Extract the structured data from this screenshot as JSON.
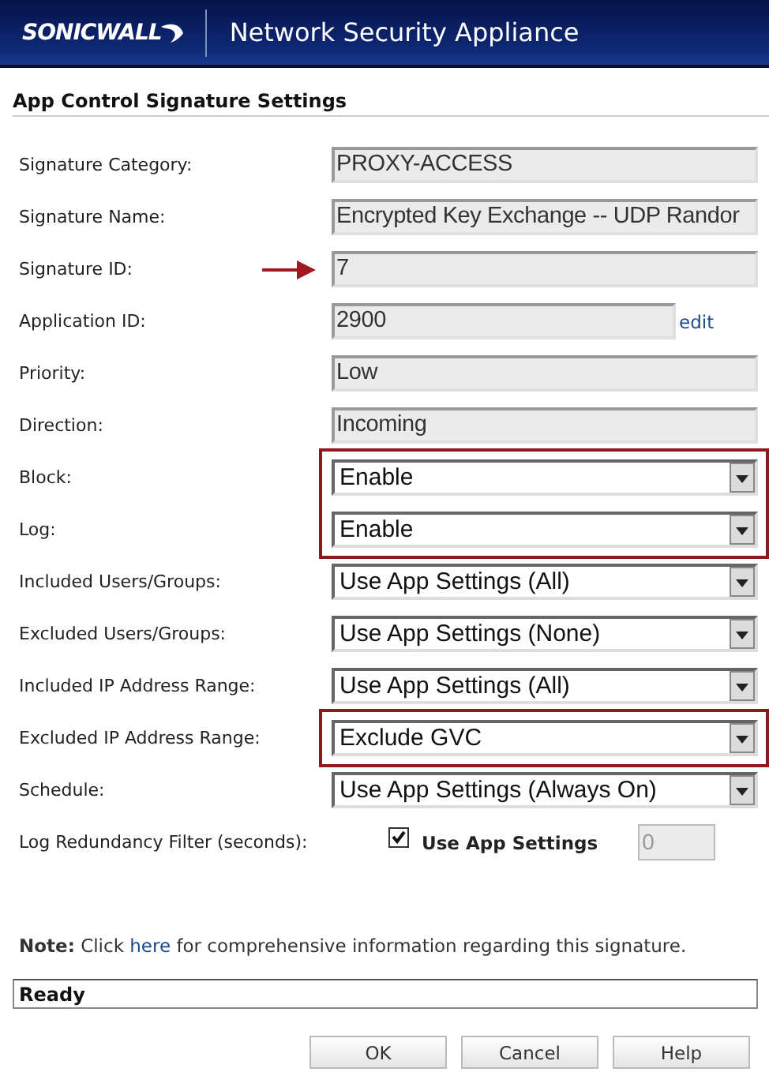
{
  "header": {
    "logo": "SONICWALL",
    "product": "Network Security Appliance"
  },
  "title": "App Control Signature Settings",
  "fields": [
    {
      "label": "Signature Category:",
      "kind": "readonly",
      "value": "PROXY-ACCESS",
      "highlighted": false,
      "pointer": false
    },
    {
      "label": "Signature Name:",
      "kind": "readonly",
      "value": "Encrypted Key Exchange -- UDP Randor",
      "highlighted": false,
      "pointer": false
    },
    {
      "label": "Signature ID:",
      "kind": "readonly",
      "value": "7",
      "highlighted": false,
      "pointer": true
    },
    {
      "label": "Application ID:",
      "kind": "readonly",
      "value": "2900",
      "link": "edit",
      "highlighted": false,
      "pointer": false
    },
    {
      "label": "Priority:",
      "kind": "readonly",
      "value": "Low",
      "highlighted": false,
      "pointer": false
    },
    {
      "label": "Direction:",
      "kind": "readonly",
      "value": "Incoming",
      "highlighted": false,
      "pointer": false
    },
    {
      "label": "Block:",
      "kind": "select",
      "value": "Enable",
      "highlighted": true,
      "pointer": false
    },
    {
      "label": "Log:",
      "kind": "select",
      "value": "Enable",
      "highlighted": true,
      "pointer": false
    },
    {
      "label": "Included Users/Groups:",
      "kind": "select",
      "value": "Use App Settings (All)",
      "highlighted": false,
      "pointer": false
    },
    {
      "label": "Excluded Users/Groups:",
      "kind": "select",
      "value": "Use App Settings (None)",
      "highlighted": false,
      "pointer": false
    },
    {
      "label": "Included IP Address Range:",
      "kind": "select",
      "value": "Use App Settings (All)",
      "highlighted": false,
      "pointer": false
    },
    {
      "label": "Excluded IP Address Range:",
      "kind": "select",
      "value": "Exclude GVC",
      "highlighted": true,
      "pointer": false
    },
    {
      "label": "Schedule:",
      "kind": "select",
      "value": "Use App Settings (Always On)",
      "highlighted": false,
      "pointer": false
    },
    {
      "label": "Log Redundancy Filter (seconds):",
      "kind": "checkbox",
      "checkbox_label": "Use App Settings",
      "checked": true,
      "value": "0",
      "disabled": true,
      "highlighted": false,
      "pointer": false
    }
  ],
  "note": "**Note:** Click ",
  "note_link": "here",
  "note_rest": " for comprehensive information regarding this signature.",
  "status_bar": "Ready",
  "buttons": [
    "OK",
    "Cancel",
    "Help"
  ]
}
